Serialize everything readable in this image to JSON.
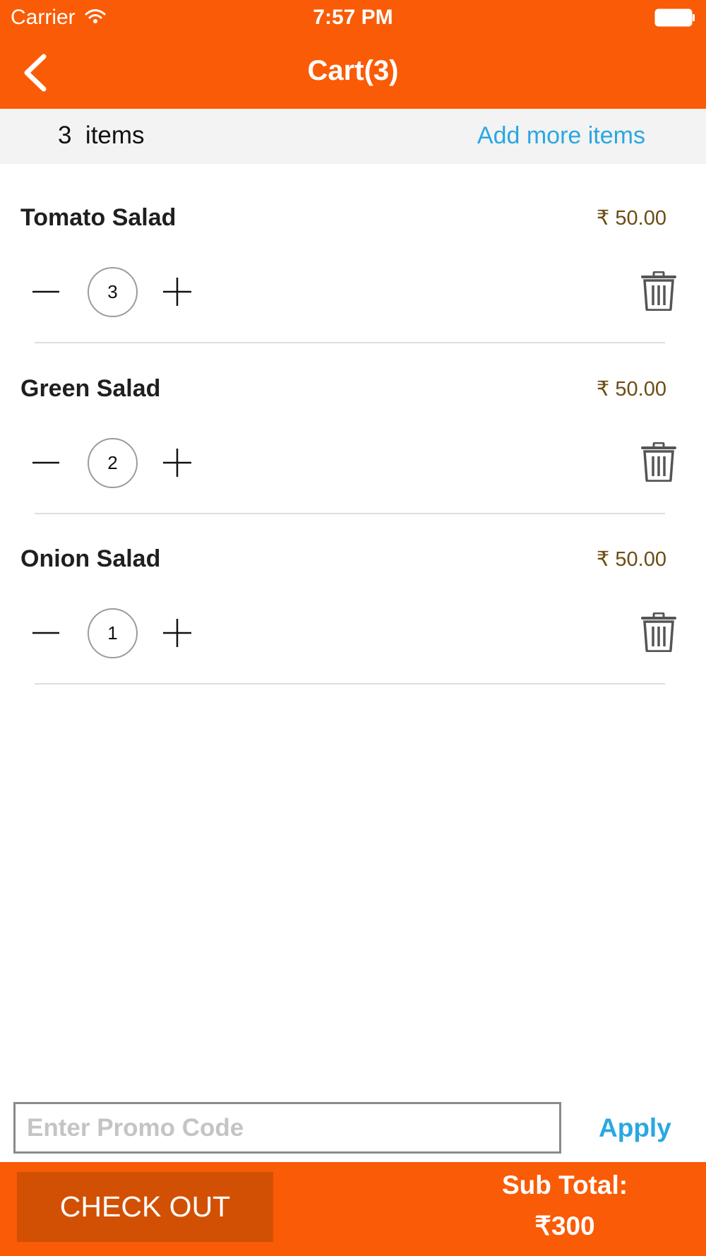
{
  "status_bar": {
    "carrier": "Carrier",
    "time": "7:57 PM"
  },
  "nav": {
    "title": "Cart(3)",
    "back_icon": "chevron-left-icon"
  },
  "summary": {
    "item_count": "3  items",
    "add_more_label": "Add more items"
  },
  "cart_items": [
    {
      "name": "Tomato Salad",
      "price": "₹ 50.00",
      "quantity": "3"
    },
    {
      "name": "Green Salad",
      "price": "₹ 50.00",
      "quantity": "2"
    },
    {
      "name": "Onion Salad",
      "price": "₹ 50.00",
      "quantity": "1"
    }
  ],
  "promo": {
    "placeholder": "Enter Promo Code",
    "value": "",
    "apply_label": "Apply"
  },
  "footer": {
    "checkout_label": "CHECK OUT",
    "subtotal_label": "Sub Total:",
    "subtotal_value": "₹300"
  },
  "colors": {
    "brand_orange": "#fa5b06",
    "checkout_dark_orange": "#d25003",
    "link_blue": "#2aa7e2",
    "price_brown": "#6d4c14",
    "summary_bg": "#f3f3f3"
  }
}
